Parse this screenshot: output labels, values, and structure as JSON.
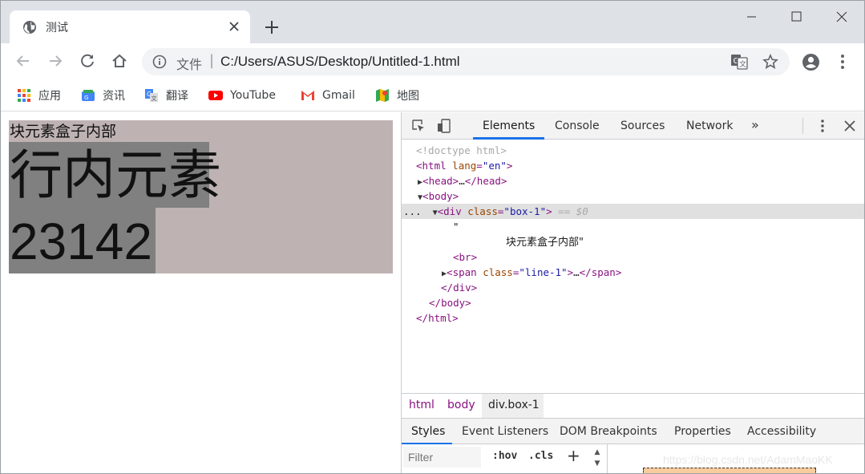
{
  "tab": {
    "title": "测试"
  },
  "omnibox": {
    "prefix": "文件",
    "separator": "|",
    "url": "C:/Users/ASUS/Desktop/Untitled-1.html"
  },
  "bookmarks": [
    {
      "label": "应用",
      "icon": "apps-grid-icon"
    },
    {
      "label": "资讯",
      "icon": "news-icon"
    },
    {
      "label": "翻译",
      "icon": "translate-icon"
    },
    {
      "label": "YouTube",
      "icon": "youtube-icon"
    },
    {
      "label": "Gmail",
      "icon": "gmail-icon"
    },
    {
      "label": "地图",
      "icon": "maps-icon"
    }
  ],
  "page": {
    "box_text": "块元素盒子内部",
    "inline_text": "行内元素",
    "inline_number": "23142"
  },
  "devtools": {
    "tabs": [
      "Elements",
      "Console",
      "Sources",
      "Network"
    ],
    "more": "»",
    "dom": {
      "doctype": "<!doctype html>",
      "html_open_tag": "html",
      "lang_attr": "lang",
      "lang_val": "\"en\"",
      "head": "head",
      "head_ellipsis": "…",
      "body": "body",
      "div": "div",
      "class_attr": "class",
      "div_class_val": "\"box-1\"",
      "selected_marker": "== $0",
      "row_dots": "...",
      "text_quote_open": "\"",
      "text_node": "块元素盒子内部\"",
      "br": "br",
      "span": "span",
      "span_class_val": "\"line-1\"",
      "span_ellipsis": "…"
    },
    "breadcrumbs": [
      "html",
      "body",
      "div.box-1"
    ],
    "styles_tabs": [
      "Styles",
      "Event Listeners",
      "DOM Breakpoints",
      "Properties",
      "Accessibility"
    ],
    "filter_placeholder": "Filter",
    "hov": ":hov",
    "cls": ".cls",
    "add": "+",
    "watermark": "https://blog.csdn.net/AdamMaoKK"
  },
  "colors": {
    "box_bg": "#beb2b3",
    "inline_bg": "#808080",
    "accent": "#1a73e8"
  }
}
